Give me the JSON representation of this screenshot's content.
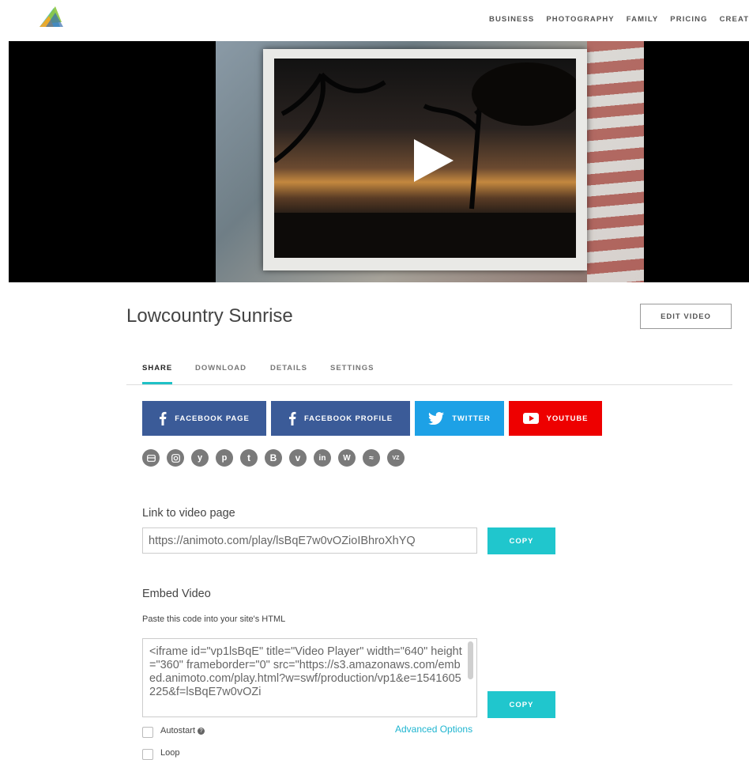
{
  "nav": {
    "items": [
      "BUSINESS",
      "PHOTOGRAPHY",
      "FAMILY",
      "PRICING",
      "CREATE"
    ]
  },
  "video": {
    "title": "Lowcountry Sunrise",
    "edit_label": "EDIT VIDEO"
  },
  "tabs": {
    "items": [
      "SHARE",
      "DOWNLOAD",
      "DETAILS",
      "SETTINGS"
    ],
    "active": "SHARE"
  },
  "share": {
    "facebook_page": "FACEBOOK PAGE",
    "facebook_profile": "FACEBOOK PROFILE",
    "twitter": "TWITTER",
    "youtube": "YOUTUBE",
    "small_icons": [
      "email-icon",
      "instagram-icon",
      "yahoo-icon",
      "pinterest-icon",
      "tumblr-icon",
      "blogger-icon",
      "vimeo-icon",
      "linkedin-icon",
      "wordpress-icon",
      "smugmug-icon",
      "vz-icon"
    ]
  },
  "link": {
    "label": "Link to video page",
    "value": "https://animoto.com/play/lsBqE7w0vOZioIBhroXhYQ",
    "copy_label": "COPY"
  },
  "embed": {
    "label": "Embed Video",
    "hint": "Paste this code into your site's HTML",
    "code": "<iframe id=\"vp1lsBqE\" title=\"Video Player\" width=\"640\" height=\"360\" frameborder=\"0\" src=\"https://s3.amazonaws.com/embed.animoto.com/play.html?w=swf/production/vp1&e=1541605225&f=lsBqE7w0vOZi",
    "copy_label": "COPY",
    "autostart_label": "Autostart",
    "loop_label": "Loop",
    "advanced_label": "Advanced Options"
  },
  "colors": {
    "accent": "#20c6cd",
    "facebook": "#3b5b98",
    "twitter": "#1da1e6",
    "youtube": "#ee0000"
  }
}
